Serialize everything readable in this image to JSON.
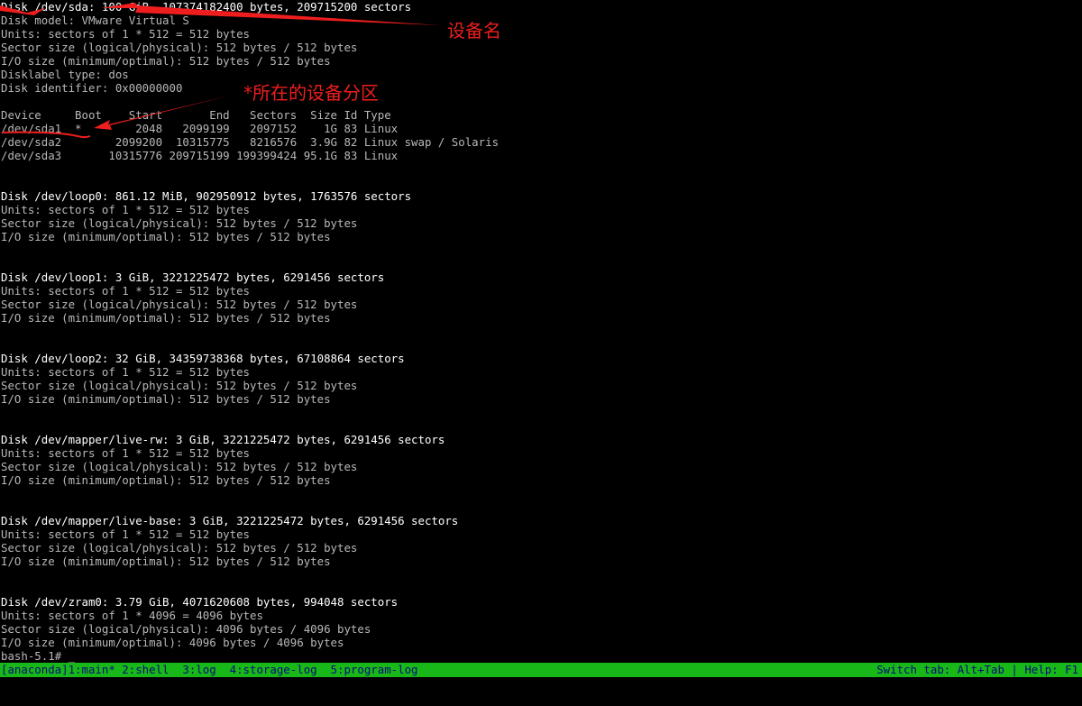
{
  "terminal": {
    "lines": [
      "Disk /dev/sda: 100 GiB, 107374182400 bytes, 209715200 sectors",
      "Disk model: VMware Virtual S",
      "Units: sectors of 1 * 512 = 512 bytes",
      "Sector size (logical/physical): 512 bytes / 512 bytes",
      "I/O size (minimum/optimal): 512 bytes / 512 bytes",
      "Disklabel type: dos",
      "Disk identifier: 0x00000000",
      "",
      "Device     Boot    Start       End   Sectors  Size Id Type",
      "/dev/sda1  *        2048   2099199   2097152    1G 83 Linux",
      "/dev/sda2        2099200  10315775   8216576  3.9G 82 Linux swap / Solaris",
      "/dev/sda3       10315776 209715199 199399424 95.1G 83 Linux",
      "",
      "",
      "Disk /dev/loop0: 861.12 MiB, 902950912 bytes, 1763576 sectors",
      "Units: sectors of 1 * 512 = 512 bytes",
      "Sector size (logical/physical): 512 bytes / 512 bytes",
      "I/O size (minimum/optimal): 512 bytes / 512 bytes",
      "",
      "",
      "Disk /dev/loop1: 3 GiB, 3221225472 bytes, 6291456 sectors",
      "Units: sectors of 1 * 512 = 512 bytes",
      "Sector size (logical/physical): 512 bytes / 512 bytes",
      "I/O size (minimum/optimal): 512 bytes / 512 bytes",
      "",
      "",
      "Disk /dev/loop2: 32 GiB, 34359738368 bytes, 67108864 sectors",
      "Units: sectors of 1 * 512 = 512 bytes",
      "Sector size (logical/physical): 512 bytes / 512 bytes",
      "I/O size (minimum/optimal): 512 bytes / 512 bytes",
      "",
      "",
      "Disk /dev/mapper/live-rw: 3 GiB, 3221225472 bytes, 6291456 sectors",
      "Units: sectors of 1 * 512 = 512 bytes",
      "Sector size (logical/physical): 512 bytes / 512 bytes",
      "I/O size (minimum/optimal): 512 bytes / 512 bytes",
      "",
      "",
      "Disk /dev/mapper/live-base: 3 GiB, 3221225472 bytes, 6291456 sectors",
      "Units: sectors of 1 * 512 = 512 bytes",
      "Sector size (logical/physical): 512 bytes / 512 bytes",
      "I/O size (minimum/optimal): 512 bytes / 512 bytes",
      "",
      "",
      "Disk /dev/zram0: 3.79 GiB, 4071620608 bytes, 994048 sectors",
      "Units: sectors of 1 * 4096 = 4096 bytes",
      "Sector size (logical/physical): 4096 bytes / 4096 bytes",
      "I/O size (minimum/optimal): 4096 bytes / 4096 bytes",
      "bash-5.1# _"
    ],
    "bright_line_indices": [
      0,
      14,
      20,
      26,
      32,
      38,
      44
    ],
    "colors": {
      "background": "#000000",
      "text": "#b8b8b8",
      "bright_text": "#ffffff"
    }
  },
  "status_bar": {
    "left_text": "[anaconda]1:main* 2:shell  3:log  4:storage-log  5:program-log",
    "right_text": "Switch tab: Alt+Tab | Help: F1",
    "colors": {
      "background": "#18b818",
      "text": "#0a0a7a"
    }
  },
  "annotations": {
    "device_name_label": "设备名",
    "boot_partition_label": "*所在的设备分区",
    "color": "#ee1e1e"
  }
}
